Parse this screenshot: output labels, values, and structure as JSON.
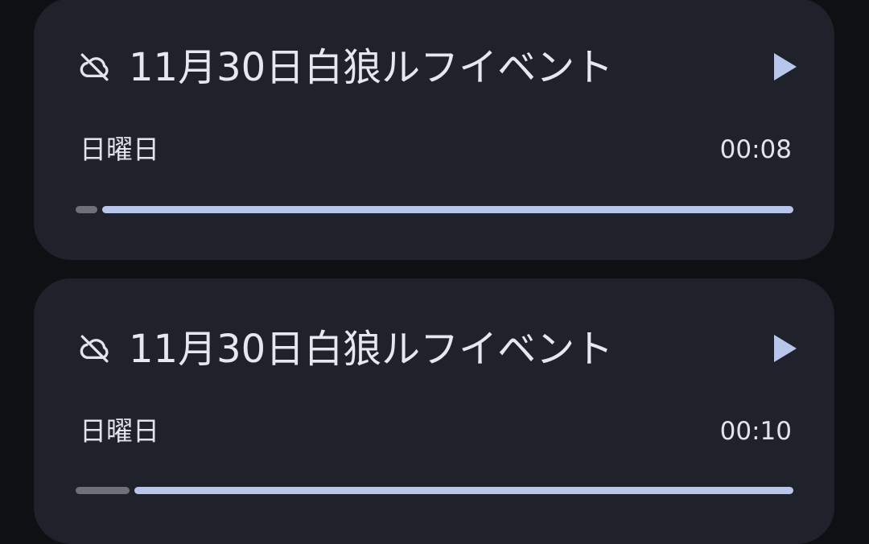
{
  "colors": {
    "background": "#0f1013",
    "card": "#1f222a",
    "text": "#e7e8ee",
    "accent": "#b8c6ec",
    "progress_played": "#6f7178"
  },
  "recordings": [
    {
      "sync_icon": "cloud-off-icon",
      "title": "11月30日白狼ルフイベント",
      "day": "日曜日",
      "duration": "00:08",
      "progress_fraction": 0.03,
      "play_icon": "play-icon"
    },
    {
      "sync_icon": "cloud-off-icon",
      "title": "11月30日白狼ルフイベント",
      "day": "日曜日",
      "duration": "00:10",
      "progress_fraction": 0.075,
      "play_icon": "play-icon"
    }
  ]
}
